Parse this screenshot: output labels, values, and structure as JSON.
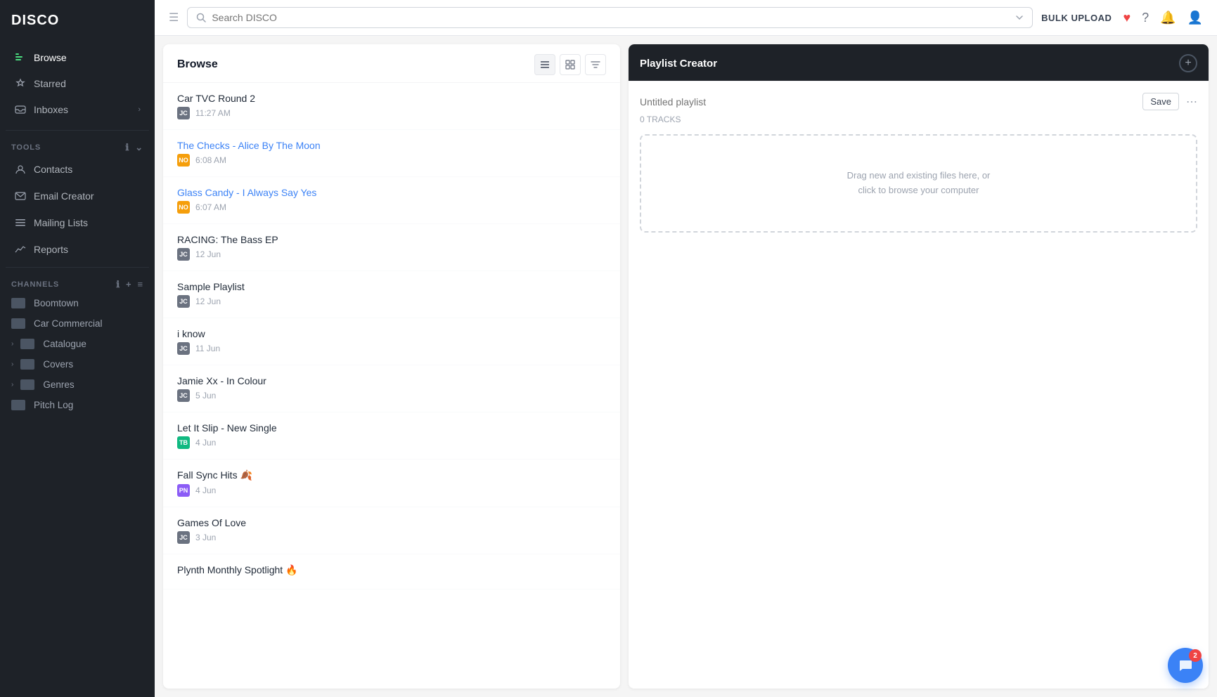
{
  "app": {
    "name": "DISCO"
  },
  "topbar": {
    "search_placeholder": "Search DISCO",
    "bulk_upload": "BULK UPLOAD"
  },
  "sidebar": {
    "nav_items": [
      {
        "id": "browse",
        "label": "Browse",
        "icon": "≡",
        "active": true
      },
      {
        "id": "starred",
        "label": "Starred",
        "icon": "☆"
      },
      {
        "id": "inboxes",
        "label": "Inboxes",
        "icon": "✉",
        "has_chevron": true
      }
    ],
    "tools_label": "TOOLS",
    "tools_items": [
      {
        "id": "contacts",
        "label": "Contacts",
        "icon": "👤"
      },
      {
        "id": "email-creator",
        "label": "Email Creator",
        "icon": "✉"
      },
      {
        "id": "mailing-lists",
        "label": "Mailing Lists",
        "icon": "☰"
      },
      {
        "id": "reports",
        "label": "Reports",
        "icon": "📈"
      }
    ],
    "channels_label": "CHANNELS",
    "channels": [
      {
        "id": "boomtown",
        "label": "Boomtown",
        "has_chevron": false
      },
      {
        "id": "car-commercial",
        "label": "Car Commercial",
        "has_chevron": false
      },
      {
        "id": "catalogue",
        "label": "Catalogue",
        "has_chevron": true
      },
      {
        "id": "covers",
        "label": "Covers",
        "has_chevron": true
      },
      {
        "id": "genres",
        "label": "Genres",
        "has_chevron": true
      },
      {
        "id": "pitch-log",
        "label": "Pitch Log",
        "has_chevron": false
      }
    ]
  },
  "browse": {
    "title": "Browse",
    "items": [
      {
        "id": 1,
        "title": "Car TVC Round 2",
        "badge": "JC",
        "badge_class": "badge-jc",
        "date": "11:27 AM",
        "is_link": false
      },
      {
        "id": 2,
        "title": "The Checks - Alice By The Moon",
        "badge": "NO",
        "badge_class": "badge-no",
        "date": "6:08 AM",
        "is_link": true
      },
      {
        "id": 3,
        "title": "Glass Candy - I Always Say Yes",
        "badge": "NO",
        "badge_class": "badge-no",
        "date": "6:07 AM",
        "is_link": true
      },
      {
        "id": 4,
        "title": "RACING: The Bass EP",
        "badge": "JC",
        "badge_class": "badge-jc",
        "date": "12 Jun",
        "is_link": false
      },
      {
        "id": 5,
        "title": "Sample Playlist",
        "badge": "JC",
        "badge_class": "badge-jc",
        "date": "12 Jun",
        "is_link": false
      },
      {
        "id": 6,
        "title": "i know",
        "badge": "JC",
        "badge_class": "badge-jc",
        "date": "11 Jun",
        "is_link": false
      },
      {
        "id": 7,
        "title": "Jamie Xx - In Colour",
        "badge": "JC",
        "badge_class": "badge-jc",
        "date": "5 Jun",
        "is_link": false
      },
      {
        "id": 8,
        "title": "Let It Slip - New Single",
        "badge": "TB",
        "badge_class": "badge-tb",
        "date": "4 Jun",
        "is_link": false
      },
      {
        "id": 9,
        "title": "Fall Sync Hits 🍂",
        "badge": "PN",
        "badge_class": "badge-pn",
        "date": "4 Jun",
        "is_link": false
      },
      {
        "id": 10,
        "title": "Games Of Love",
        "badge": "JC",
        "badge_class": "badge-jc",
        "date": "3 Jun",
        "is_link": false
      },
      {
        "id": 11,
        "title": "Plynth Monthly Spotlight 🔥",
        "badge": "",
        "badge_class": "",
        "date": "",
        "is_link": false
      }
    ]
  },
  "playlist_creator": {
    "title": "Playlist Creator",
    "name_placeholder": "Untitled playlist",
    "save_label": "Save",
    "tracks_count": "0 TRACKS",
    "drop_zone_text": "Drag new and existing files here, or\nclick to browse your computer"
  },
  "chat": {
    "badge": "2"
  }
}
